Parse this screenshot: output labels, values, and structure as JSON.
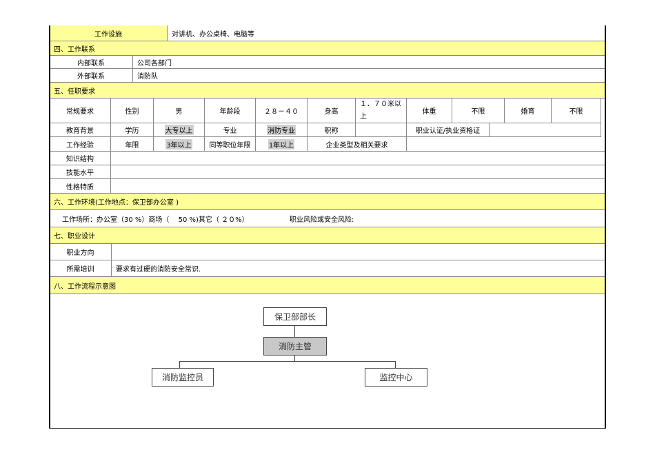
{
  "facilities": {
    "label": "工作设施",
    "value": "对讲机、办公桌椅、电脑等"
  },
  "s4": {
    "title": "四、工作联系",
    "internal_label": "内部联系",
    "internal_value": "公司各部门",
    "external_label": "外部联系",
    "external_value": "消防队"
  },
  "s5": {
    "title": "五、任职要求",
    "r1": [
      "常规要求",
      "性别",
      "男",
      "年龄段",
      "２８－４０",
      "身高",
      "１．７０米以上",
      "体重",
      "不限",
      "婚育",
      "不限"
    ],
    "r2": [
      "教育背景",
      "学历",
      "大专以上",
      "专业",
      "消防专业",
      "职称",
      "",
      "职业认证/执业资格证",
      ""
    ],
    "r3": [
      "工作经验",
      "年限",
      "3年以上",
      "同等职位年限",
      "1年以上",
      "企业类型及相关要求",
      ""
    ],
    "knowledge": "知识结构",
    "skill": "技能水平",
    "personality": "性格特质"
  },
  "s6": {
    "title": "六、工作环境(工作地点：保卫部办公室 )",
    "place": "工作场所：办公室（30 %）商场（　 50 %)其它（ ２０%）",
    "risk": "职业风险或安全风险:"
  },
  "s7": {
    "title": "七、职业设计",
    "direction_label": "职业方向",
    "training_label": "所需培训",
    "training_value": "要求有过硬的消防安全常识."
  },
  "s8": {
    "title": "八、工作流程示意图",
    "chart": {
      "top": "保卫部部长",
      "mid": "消防主管",
      "left": "消防监控员",
      "right": "监控中心"
    }
  }
}
